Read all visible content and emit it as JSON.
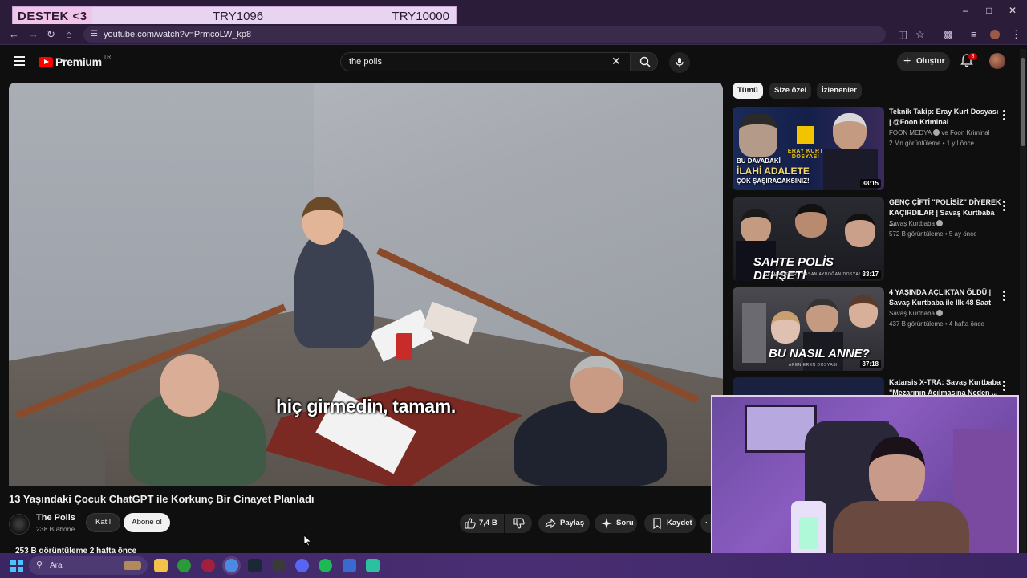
{
  "overlay": {
    "destek": "DESTEK",
    "heart": "<3",
    "mid": "TRY1096",
    "right": "TRY10000"
  },
  "browser": {
    "url": "youtube.com/watch?v=PrmcoLW_kp8"
  },
  "header": {
    "logo_word": "Premium",
    "logo_region": "TR",
    "search_value": "the polis",
    "create_label": "Oluştur",
    "notification_count": "8"
  },
  "player": {
    "subtitle": "hiç girmedin, tamam."
  },
  "video": {
    "title": "13 Yaşındaki Çocuk ChatGPT ile Korkunç Bir Cinayet Planladı",
    "channel": "The Polis",
    "subscribers": "238 B abone",
    "join_label": "Katıl",
    "subscribe_label": "Abone ol",
    "likes": "7,4 B",
    "share_label": "Paylaş",
    "ask_label": "Soru",
    "save_label": "Kaydet",
    "views_line": "253 B görüntüleme  2 hafta önce"
  },
  "filters": [
    "Tümü",
    "Size özel",
    "İzlenenler"
  ],
  "recommendations": [
    {
      "title": "Teknik Takip: Eray Kurt Dosyası | @Foon Kriminal",
      "channel": "FOON MEDYA",
      "channel_extra": "ve Foon Kriminal",
      "meta": "2 Mn görüntüleme • 1 yıl önce",
      "duration": "38:15",
      "thumb_lines": [
        "BU DAVADAKİ",
        "İLAHİ ADALETE",
        "ÇOK ŞAŞIRACAKSINIZ!"
      ],
      "thumb_badge": "ERAY KURT DOSYASI"
    },
    {
      "title": "GENÇ ÇİFTİ \"POLİSİZ\" DİYEREK KAÇIRDILAR | Savaş Kurtbaba ...",
      "channel": "Savaş Kurtbaba",
      "channel_extra": "",
      "meta": "572 B görüntüleme • 5 ay önce",
      "duration": "33:17",
      "thumb_lines": [
        "SAHTE POLİS DEHŞETİ"
      ],
      "thumb_badge": "ŞEYMA DEMİR - HASAN AYDOĞAN DOSYASI"
    },
    {
      "title": "4 YAŞINDA AÇLIKTAN ÖLDÜ | Savaş Kurtbaba ile İlk 48 Saat",
      "channel": "Savaş Kurtbaba",
      "channel_extra": "",
      "meta": "437 B görüntüleme • 4 hafta önce",
      "duration": "37:18",
      "thumb_lines": [
        "BU NASIL ANNE?"
      ],
      "thumb_badge": "AREN EREN DOSYASI"
    },
    {
      "title": "Katarsis X-TRA: Savaş Kurtbaba \"Mezarının Açılmasına Neden ...",
      "channel": "",
      "channel_extra": "",
      "meta": "",
      "duration": "",
      "thumb_lines": [],
      "thumb_badge": ""
    }
  ],
  "taskbar": {
    "search_placeholder": "Ara"
  }
}
